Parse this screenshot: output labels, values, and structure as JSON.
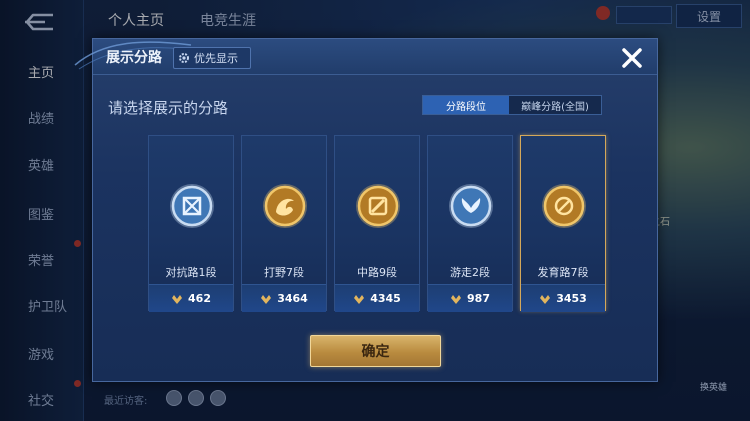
{
  "top_tabs": [
    "个人主页",
    "电竞生涯"
  ],
  "left_nav": [
    {
      "label": "主页",
      "active": true,
      "dot": false
    },
    {
      "label": "战绩",
      "active": false,
      "dot": false
    },
    {
      "label": "英雄",
      "active": false,
      "dot": false
    },
    {
      "label": "图鉴",
      "active": false,
      "dot": false
    },
    {
      "label": "荣誉",
      "active": false,
      "dot": true
    },
    {
      "label": "护卫队",
      "active": false,
      "dot": false
    },
    {
      "label": "游戏",
      "active": false,
      "dot": false
    },
    {
      "label": "社交",
      "active": false,
      "dot": true
    }
  ],
  "settings_label": "设置",
  "visitors_label": "最近访客:",
  "right_side_label": "之石",
  "right_button_label": "换英雄",
  "dialog": {
    "title": "展示分路",
    "priority_label": "优先显示",
    "prompt": "请选择展示的分路",
    "segments": [
      {
        "label": "分路段位",
        "active": true
      },
      {
        "label": "巅峰分路(全国)",
        "active": false
      }
    ],
    "cards": [
      {
        "label": "对抗路1段",
        "value": "462",
        "emblem": "shield-crossed-swords-emblem",
        "tone": "silver",
        "selected": false
      },
      {
        "label": "打野7段",
        "value": "3464",
        "emblem": "dragon-claw-emblem",
        "tone": "gold",
        "selected": false
      },
      {
        "label": "中路9段",
        "value": "4345",
        "emblem": "slash-emblem",
        "tone": "gold",
        "selected": false
      },
      {
        "label": "游走2段",
        "value": "987",
        "emblem": "wings-emblem",
        "tone": "silver",
        "selected": false
      },
      {
        "label": "发育路7段",
        "value": "3453",
        "emblem": "crosshair-emblem",
        "tone": "gold",
        "selected": true
      }
    ],
    "confirm_label": "确定"
  },
  "colors": {
    "gold": "#d4a85a",
    "panel": "#1b3360",
    "accent_blue": "#2d62b3"
  }
}
